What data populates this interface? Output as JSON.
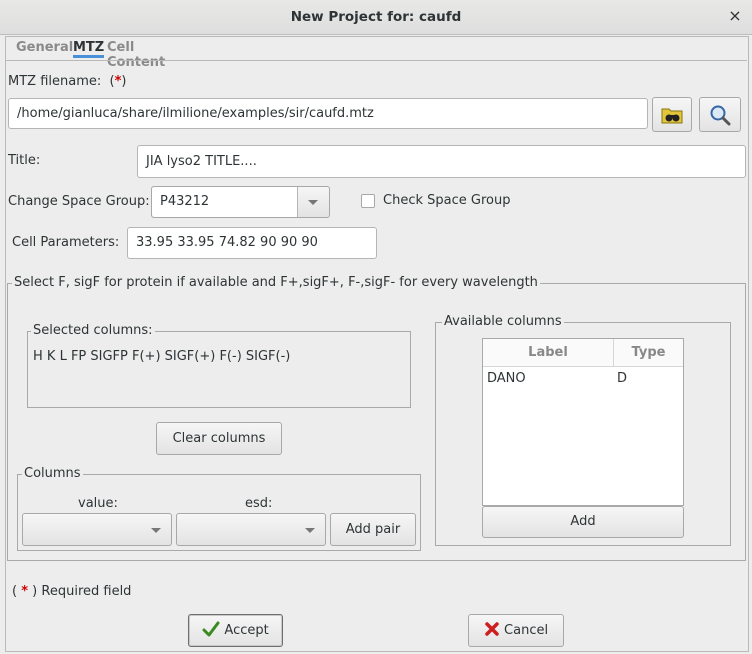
{
  "window": {
    "title": "New Project for: caufd",
    "close_glyph": "×"
  },
  "tabs": [
    {
      "label": "General"
    },
    {
      "label": "MTZ"
    },
    {
      "label": "Cell Content"
    }
  ],
  "mtz": {
    "filename_label": "MTZ filename:",
    "required_marker": "*",
    "filename_value": "/home/gianluca/share/ilmilione/examples/sir/caufd.mtz",
    "title_label": "Title:",
    "title_value": "JIA lyso2 TITLE....",
    "space_group_label": "Change Space Group:",
    "space_group_value": "P43212",
    "check_space_group_label": "Check Space Group",
    "cell_label": "Cell Parameters:",
    "cell_value": "33.95 33.95 74.82 90 90 90"
  },
  "select_group": {
    "legend": "Select F, sigF for protein  if available and F+,sigF+, F-,sigF- for every wavelength",
    "selected_legend": "Selected columns:",
    "selected_value": "H K L FP SIGFP F(+) SIGF(+) F(-) SIGF(-)",
    "clear_button": "Clear columns",
    "columns_legend": "Columns",
    "value_label": "value:",
    "esd_label": "esd:",
    "add_pair_button": "Add pair",
    "available_legend": "Available columns",
    "table_headers": [
      "Label",
      "Type"
    ],
    "table_rows": [
      {
        "label": "DANO",
        "type": "D"
      }
    ],
    "add_button": "Add"
  },
  "footer": {
    "required_text": "Required field",
    "accept_button": "Accept",
    "cancel_button": "Cancel"
  },
  "icons": {
    "browse": "folder-binoculars-icon",
    "inspect": "magnifier-icon",
    "accept": "checkmark-icon",
    "cancel": "x-icon",
    "accent_color": "#4a90d9",
    "required_color": "#cc0000"
  }
}
